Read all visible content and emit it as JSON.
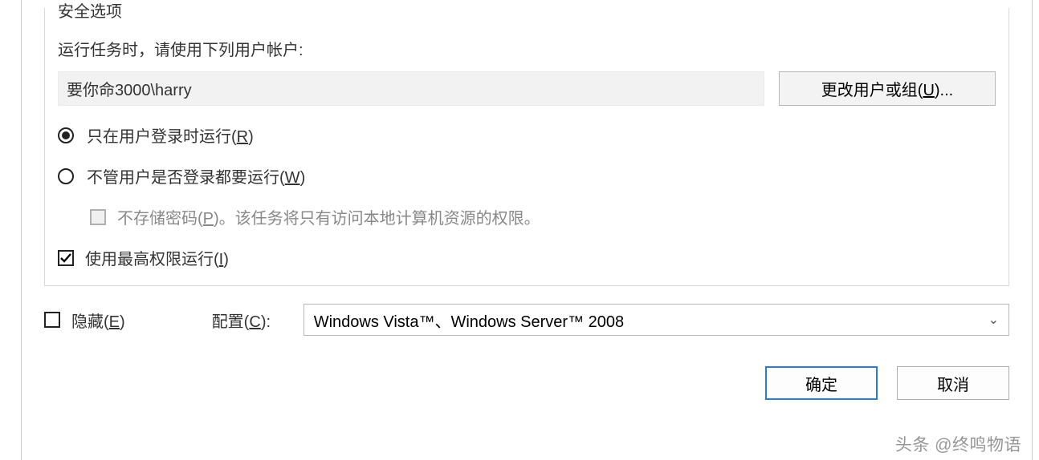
{
  "security": {
    "legend": "安全选项",
    "account_label": "运行任务时，请使用下列用户帐户:",
    "account_value": "要你命3000\\harry",
    "change_button_pre": "更改用户或组(",
    "change_button_key": "U",
    "change_button_post": ")...",
    "radio_logged_pre": "只在用户登录时运行(",
    "radio_logged_key": "R",
    "radio_logged_post": ")",
    "radio_always_pre": "不管用户是否登录都要运行(",
    "radio_always_key": "W",
    "radio_always_post": ")",
    "no_store_pre": "不存储密码(",
    "no_store_key": "P",
    "no_store_post": ")。该任务将只有访问本地计算机资源的权限。",
    "highest_pre": "使用最高权限运行(",
    "highest_key": "I",
    "highest_post": ")"
  },
  "hidden": {
    "label_pre": "隐藏(",
    "label_key": "E",
    "label_post": ")"
  },
  "config": {
    "label_pre": "配置(",
    "label_key": "C",
    "label_post": "):",
    "value": "Windows Vista™、Windows Server™ 2008"
  },
  "buttons": {
    "ok": "确定",
    "cancel": "取消"
  },
  "watermark": "头条 @终鸣物语"
}
